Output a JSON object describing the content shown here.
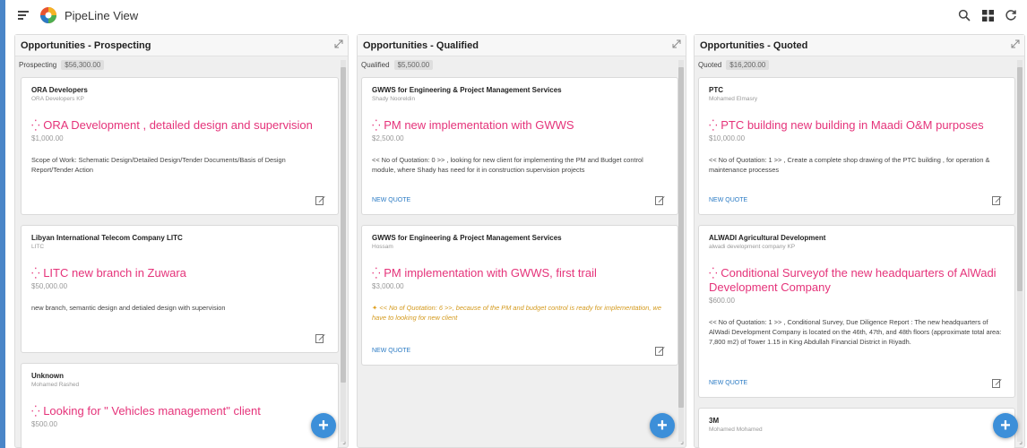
{
  "app": {
    "title": "PipeLine View"
  },
  "icons": {
    "menu": "hamburger-icon",
    "search": "search-icon",
    "grid": "grid-icon",
    "refresh": "refresh-icon",
    "expand": "expand-icon",
    "edit": "edit-icon",
    "add": "plus-icon",
    "loading": "spinner-icon"
  },
  "colors": {
    "accent": "#e5337a",
    "link": "#2b7bc4",
    "fab": "#3c8fd9",
    "note": "#d49a1e"
  },
  "columns": [
    {
      "title": "Opportunities - Prospecting",
      "stage": "Prospecting",
      "amount": "$56,300.00",
      "cards": [
        {
          "company": "ORA Developers",
          "contact": "ORA Developers KP",
          "opportunity": "ORA Development , detailed design and supervision",
          "value": "$1,000.00",
          "description": "Scope of Work: Schematic Design/Detailed Design/Tender Documents/Basis of Design Report/Tender Action"
        },
        {
          "company": "Libyan International Telecom Company LITC",
          "contact": "LITC",
          "opportunity": "LITC new branch in Zuwara",
          "value": "$50,000.00",
          "description": "new branch, semantic design and detialed design with supervision"
        },
        {
          "company": "Unknown",
          "contact": "Mohamed Rashed",
          "opportunity": "Looking for \" Vehicles management\" client",
          "value": "$500.00"
        }
      ]
    },
    {
      "title": "Opportunities - Qualified",
      "stage": "Qualified",
      "amount": "$5,500.00",
      "cards": [
        {
          "company": "GWWS for Engineering & Project Management Services",
          "contact": "Shady Nooreldin",
          "opportunity": "PM new implementation with GWWS",
          "value": "$2,500.00",
          "description": "<< No of Quotation: 0 >> , looking for new client for implementing the PM and Budget control module, where Shady has need for it in construction supervision projects",
          "link": "NEW QUOTE"
        },
        {
          "company": "GWWS for Engineering & Project Management Services",
          "contact": "Hossam",
          "opportunity": "PM implementation with GWWS, first trail",
          "value": "$3,000.00",
          "note": "<< No of Quotation: 6 >>, because of the PM and budget control is ready for implementation, we have to looking for new client",
          "link": "NEW QUOTE"
        }
      ]
    },
    {
      "title": "Opportunities - Quoted",
      "stage": "Quoted",
      "amount": "$16,200.00",
      "cards": [
        {
          "company": "PTC",
          "contact": "Mohamed Elmasry",
          "opportunity": "PTC building new building in Maadi O&M purposes",
          "value": "$10,000.00",
          "description": "<< No of Quotation: 1 >> , Create a complete shop drawing of the PTC building , for operation & maintenance processes",
          "link": "NEW QUOTE"
        },
        {
          "company": "ALWADI Agricultural Development",
          "contact": "alwadi development company KP",
          "opportunity": "Conditional Surveyof the new headquarters of AlWadi Development Company",
          "value": "$600.00",
          "description": "<< No of Quotation: 1 >> , Conditional Survey, Due Diligence Report : The new headquarters of AlWadi Development Company is located on the 46th, 47th, and 48th floors (approximate total area: 7,800 m2) of Tower 1.15 in King Abdullah Financial District in Riyadh.",
          "link": "NEW QUOTE"
        },
        {
          "company": "3M",
          "contact": "Mohamed Mohamed"
        }
      ]
    }
  ]
}
